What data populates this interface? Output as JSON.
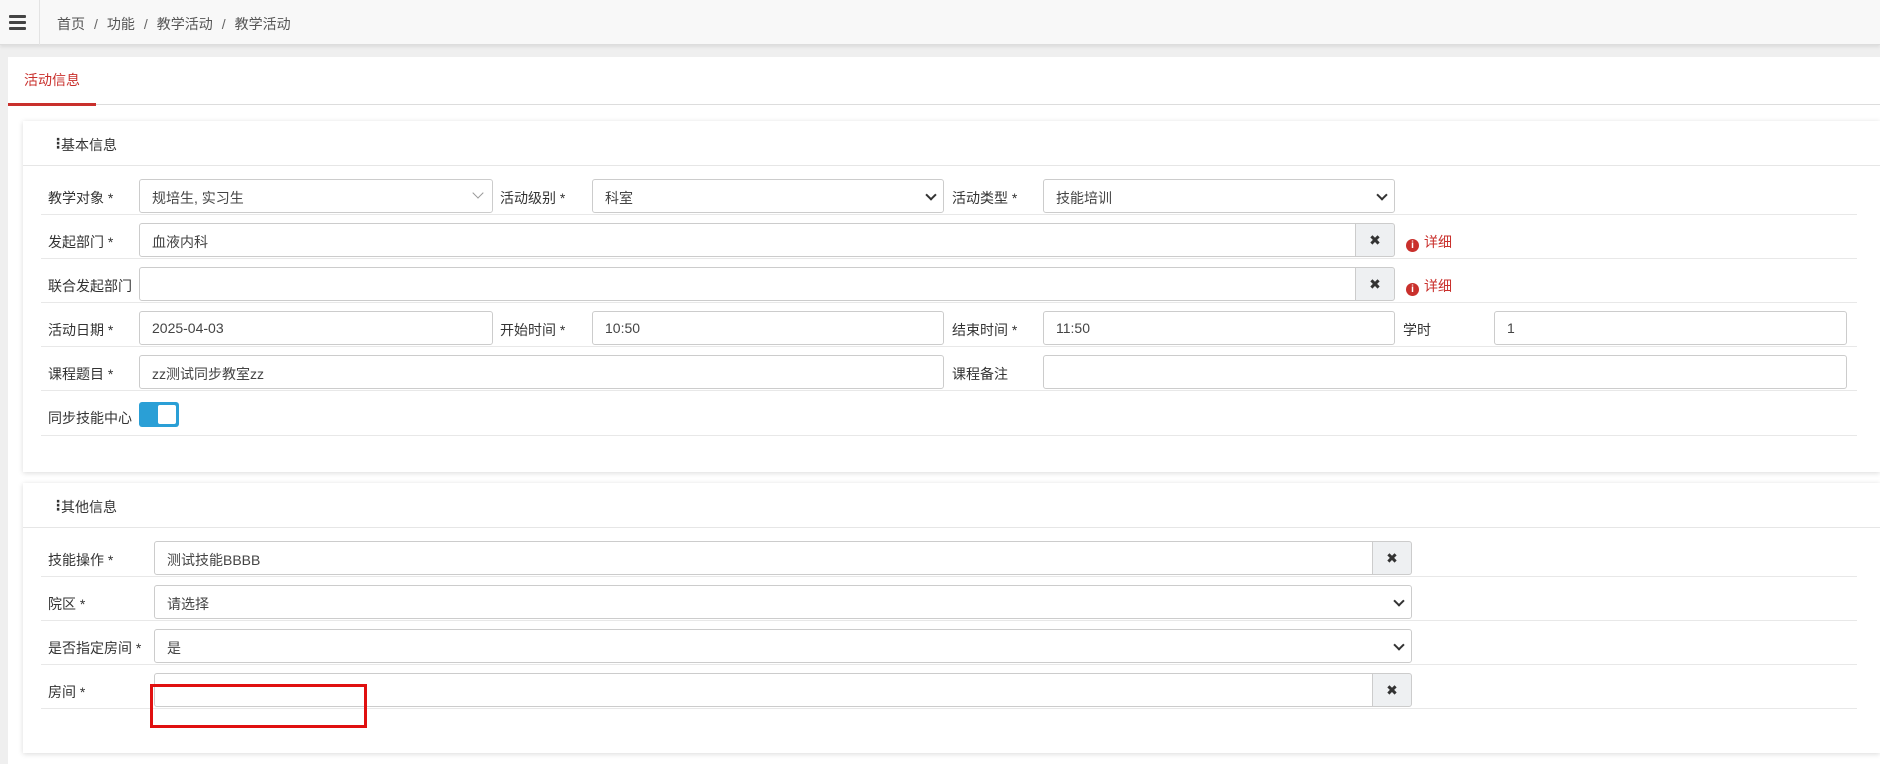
{
  "breadcrumb": [
    "首页",
    "功能",
    "教学活动",
    "教学活动"
  ],
  "tab": {
    "label": "活动信息"
  },
  "basic": {
    "title": "基本信息",
    "target_label": "教学对象 *",
    "target_value": "规培生, 实习生",
    "level_label": "活动级别 *",
    "level_value": "科室",
    "type_label": "活动类型 *",
    "type_value": "技能培训",
    "dept_label": "发起部门 *",
    "dept_value": "血液内科",
    "joint_label": "联合发起部门",
    "joint_value": "",
    "clear_symbol": "✖",
    "detail_icon": "i",
    "detail_label": "详细",
    "date_label": "活动日期 *",
    "date_value": "2025-04-03",
    "start_label": "开始时间 *",
    "start_value": "10:50",
    "end_label": "结束时间 *",
    "end_value": "11:50",
    "hours_label": "学时",
    "hours_value": "1",
    "topic_label": "课程题目 *",
    "topic_value": "zz测试同步教室zz",
    "note_label": "课程备注",
    "note_value": "",
    "sync_label": "同步技能中心",
    "sync_on": true
  },
  "other": {
    "title": "其他信息",
    "skill_label": "技能操作 *",
    "skill_value": "测试技能BBBB",
    "campus_label": "院区 *",
    "campus_value": "请选择",
    "room_specify_label": "是否指定房间 *",
    "room_specify_value": "是",
    "room_label": "房间 *",
    "room_value": ""
  },
  "colors": {
    "accent": "#c9302c",
    "toggle": "#2a9fd6",
    "highlight": "#e01010"
  }
}
